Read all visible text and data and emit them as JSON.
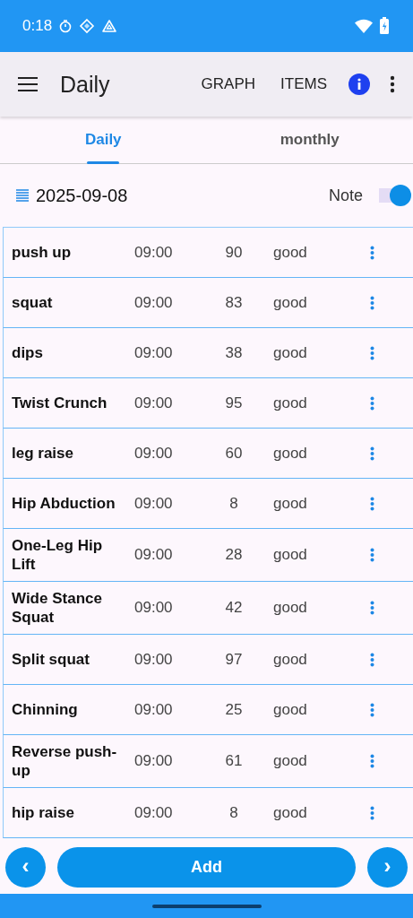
{
  "status_bar": {
    "time": "0:18"
  },
  "app_bar": {
    "title": "Daily",
    "actions": [
      "GRAPH",
      "ITEMS"
    ]
  },
  "tabs": [
    {
      "label": "Daily",
      "selected": true
    },
    {
      "label": "monthly",
      "selected": false
    }
  ],
  "date_row": {
    "date": "2025-09-08",
    "note_label": "Note",
    "note_on": true
  },
  "rows": [
    {
      "name": "push up",
      "time": "09:00",
      "value": "90",
      "rating": "good"
    },
    {
      "name": "squat",
      "time": "09:00",
      "value": "83",
      "rating": "good"
    },
    {
      "name": "dips",
      "time": "09:00",
      "value": "38",
      "rating": "good"
    },
    {
      "name": "Twist Crunch",
      "time": "09:00",
      "value": "95",
      "rating": "good"
    },
    {
      "name": "leg raise",
      "time": "09:00",
      "value": "60",
      "rating": "good"
    },
    {
      "name": "Hip Abduction",
      "time": "09:00",
      "value": "8",
      "rating": "good"
    },
    {
      "name": "One-Leg Hip Lift",
      "time": "09:00",
      "value": "28",
      "rating": "good"
    },
    {
      "name": "Wide Stance Squat",
      "time": "09:00",
      "value": "42",
      "rating": "good"
    },
    {
      "name": "Split squat",
      "time": "09:00",
      "value": "97",
      "rating": "good"
    },
    {
      "name": "Chinning",
      "time": "09:00",
      "value": "25",
      "rating": "good"
    },
    {
      "name": "Reverse push-up",
      "time": "09:00",
      "value": "61",
      "rating": "good"
    },
    {
      "name": "hip raise",
      "time": "09:00",
      "value": "8",
      "rating": "good"
    }
  ],
  "bottom_bar": {
    "prev": "‹",
    "add": "Add",
    "next": "›"
  }
}
